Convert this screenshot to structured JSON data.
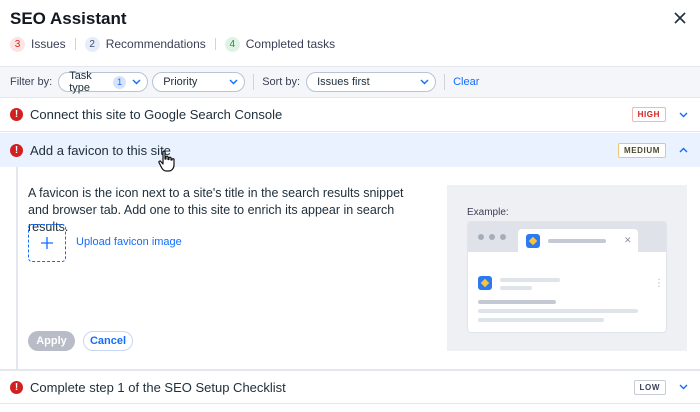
{
  "header": {
    "title": "SEO Assistant",
    "close_icon": "close-icon"
  },
  "stats": [
    {
      "count": "3",
      "label": "Issues",
      "color": "#c92d27"
    },
    {
      "count": "2",
      "label": "Recommendations",
      "color": "#3a4f78"
    },
    {
      "count": "4",
      "label": "Completed tasks",
      "color": "#2e8a48"
    }
  ],
  "filters": {
    "filter_by_label": "Filter by:",
    "task_type": {
      "value": "Task type",
      "badge": "1"
    },
    "priority": {
      "value": "Priority"
    },
    "sort_by_label": "Sort by:",
    "sort": {
      "value": "Issues first"
    },
    "clear_label": "Clear"
  },
  "tasks": [
    {
      "title": "Connect this site to Google Search Console",
      "priority": "HIGH",
      "expanded": false
    },
    {
      "title": "Add a favicon to this site",
      "priority": "MEDIUM",
      "expanded": true
    },
    {
      "title": "Complete step 1 of the SEO Setup Checklist",
      "priority": "LOW",
      "expanded": false
    }
  ],
  "detail": {
    "description": "A favicon is the icon next to a site's title in the search results snippet and browser tab. Add one to this site to enrich its appear in search results.",
    "upload_label": "Upload favicon image",
    "apply_label": "Apply",
    "cancel_label": "Cancel",
    "example_label": "Example:"
  },
  "colors": {
    "accent": "#116dff",
    "alert": "#d12020",
    "expanded_row": "#eaf1ff"
  }
}
